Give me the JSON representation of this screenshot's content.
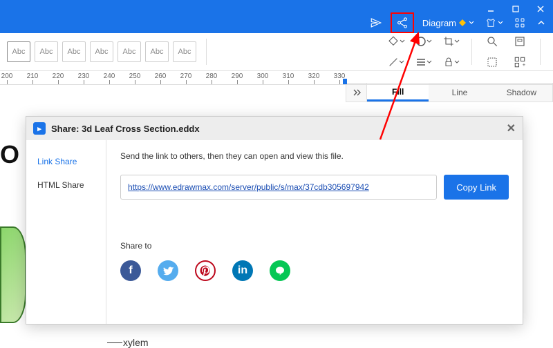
{
  "titlebar": {
    "menu_diagram": "Diagram"
  },
  "toolbar": {
    "abc": "Abc"
  },
  "ruler": {
    "ticks": [
      200,
      210,
      220,
      230,
      240,
      250,
      260,
      270,
      280,
      290,
      300,
      310,
      320,
      330
    ]
  },
  "props": {
    "tab_fill": "Fill",
    "tab_line": "Line",
    "tab_shadow": "Shadow"
  },
  "dialog": {
    "title": "Share: 3d Leaf Cross Section.eddx",
    "sidebar": {
      "link_share": "Link Share",
      "html_share": "HTML Share"
    },
    "instruction": "Send the link to others, then they can open and view this file.",
    "link": "https://www.edrawmax.com/server/public/s/max/37cdb305697942",
    "copy_label": "Copy Link",
    "share_to": "Share to"
  },
  "canvas": {
    "label_xylem": "xylem",
    "text_o": "O"
  }
}
